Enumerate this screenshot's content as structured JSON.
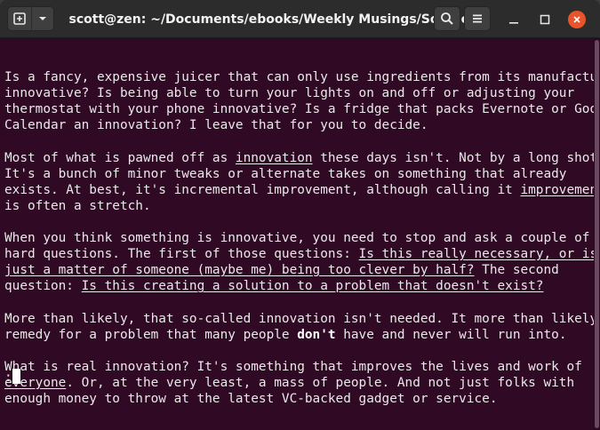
{
  "window": {
    "title": "scott@zen: ~/Documents/ebooks/Weekly Musings/Sources",
    "colors": {
      "terminal_bg": "#300a24",
      "titlebar_bg": "#2c2c2c",
      "close_button": "#e9542a",
      "text": "#e9e9e9"
    }
  },
  "titlebar_icons": {
    "new_tab": "new-tab-icon",
    "tab_menu": "chevron-down-icon",
    "search": "search-icon",
    "menu": "hamburger-icon",
    "minimize": "minimize-icon",
    "maximize": "maximize-icon",
    "close": "close-icon"
  },
  "terminal": {
    "lines": [
      [
        {
          "t": ""
        }
      ],
      [
        {
          "t": "Is a fancy, expensive juicer that can only use ingredients from its manufacturer"
        }
      ],
      [
        {
          "t": "innovative? Is being able to turn your lights on and off or adjusting your"
        }
      ],
      [
        {
          "t": "thermostat with your phone innovative? Is a fridge that packs Evernote or Google"
        }
      ],
      [
        {
          "t": "Calendar an innovation? I leave that for you to decide."
        }
      ],
      [
        {
          "t": ""
        }
      ],
      [
        {
          "t": "Most of what is pawned off as "
        },
        {
          "t": "innovation",
          "s": "u"
        },
        {
          "t": " these days isn't. Not by a long shot."
        }
      ],
      [
        {
          "t": "It's a bunch of minor tweaks or alternate takes on something that already"
        }
      ],
      [
        {
          "t": "exists. At best, it's incremental improvement, although calling it "
        },
        {
          "t": "improvement",
          "s": "u"
        }
      ],
      [
        {
          "t": "is often a stretch."
        }
      ],
      [
        {
          "t": ""
        }
      ],
      [
        {
          "t": "When you think something is innovative, you need to stop and ask a couple of"
        }
      ],
      [
        {
          "t": "hard questions. The first of those questions: "
        },
        {
          "t": "Is this really necessary, or is it",
          "s": "u"
        }
      ],
      [
        {
          "t": "just a matter of someone (maybe me) being too clever by half?",
          "s": "u"
        },
        {
          "t": " The second"
        }
      ],
      [
        {
          "t": "question: "
        },
        {
          "t": "Is this creating a solution to a problem that doesn't exist?",
          "s": "u"
        }
      ],
      [
        {
          "t": ""
        }
      ],
      [
        {
          "t": "More than likely, that so-called innovation isn't needed. It more than likely a"
        }
      ],
      [
        {
          "t": "remedy for a problem that many people "
        },
        {
          "t": "don't",
          "s": "b"
        },
        {
          "t": " have and never will run into."
        }
      ],
      [
        {
          "t": ""
        }
      ],
      [
        {
          "t": "What is real innovation? It's something that improves the lives and work of"
        }
      ],
      [
        {
          "t": "everyone",
          "s": "u"
        },
        {
          "t": ". Or, at the very least, a mass of people. And not just folks with"
        }
      ],
      [
        {
          "t": "enough money to throw at the latest VC-backed gadget or service."
        }
      ]
    ],
    "prompt": ":"
  }
}
